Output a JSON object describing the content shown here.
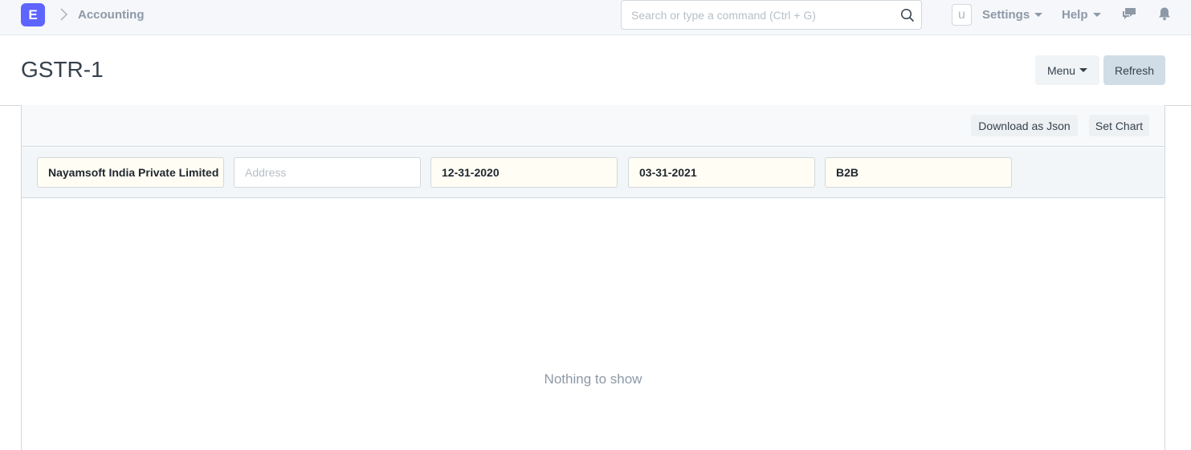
{
  "navbar": {
    "logo_letter": "E",
    "breadcrumb": "Accounting",
    "search_placeholder": "Search or type a command (Ctrl + G)",
    "avatar_letter": "u",
    "settings_label": "Settings",
    "help_label": "Help"
  },
  "page": {
    "title": "GSTR-1",
    "menu_label": "Menu",
    "refresh_label": "Refresh"
  },
  "toolbar": {
    "download_json_label": "Download as Json",
    "set_chart_label": "Set Chart"
  },
  "filters": {
    "company": "Nayamsoft India Private Limited",
    "address_placeholder": "Address",
    "from_date": "12-31-2020",
    "to_date": "03-31-2021",
    "type_of_business": "B2B"
  },
  "report": {
    "empty_message": "Nothing to show"
  },
  "colors": {
    "brand": "#5e64ff",
    "refresh_button": "#d1dde6",
    "filled_field_bg": "#fffdf4"
  }
}
